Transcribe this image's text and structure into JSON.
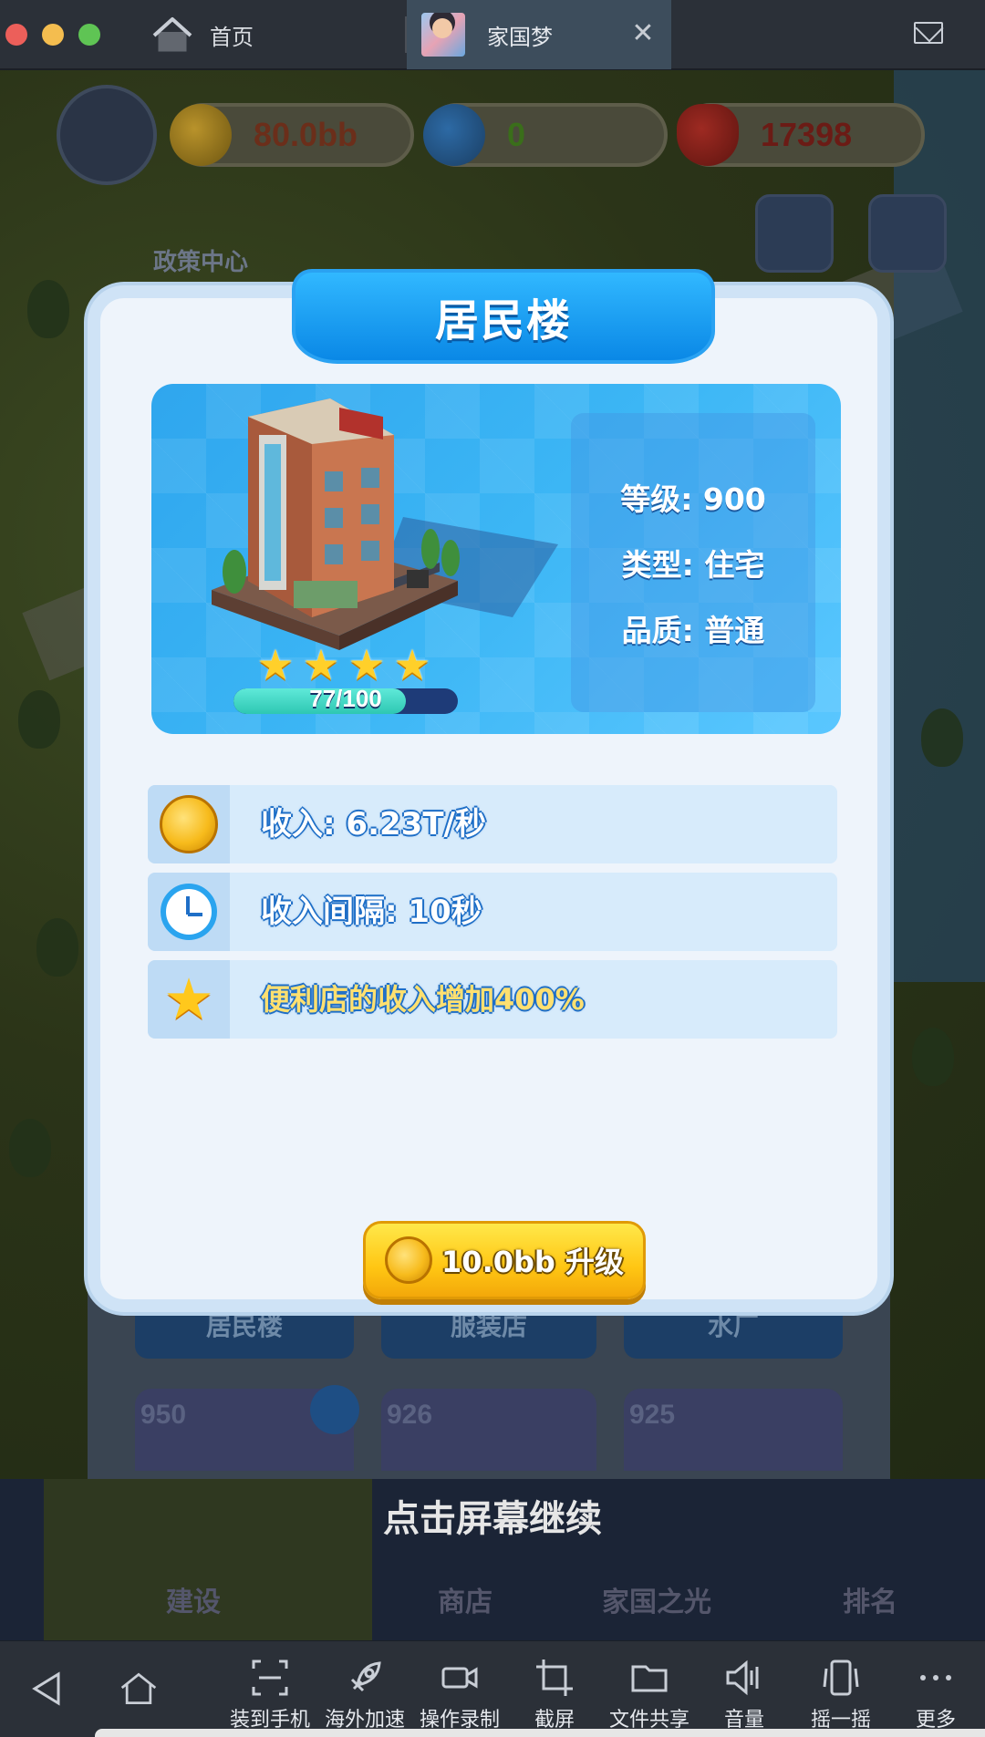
{
  "window": {
    "tabs": [
      {
        "label": "首页",
        "icon": "home-icon"
      },
      {
        "label": "家国梦",
        "icon": "game-thumbnail",
        "close": "✕"
      }
    ],
    "mail_icon": "mail-icon"
  },
  "hud": {
    "coins": "80.0bb",
    "stars": "0",
    "hearts": "17398",
    "policy_center": "政策中心"
  },
  "modal": {
    "title": "居民楼",
    "stats": {
      "level": "等级: 900",
      "type": "类型: 住宅",
      "quality": "品质: 普通"
    },
    "star_count": 4,
    "progress": {
      "current": 77,
      "max": 100,
      "label": "77/100"
    },
    "attributes": [
      {
        "icon": "coin-icon",
        "text": "收入: 6.23T/秒"
      },
      {
        "icon": "clock-icon",
        "text": "收入间隔: 10秒"
      },
      {
        "icon": "star-icon",
        "text": "便利店的收入增加400%"
      }
    ],
    "upgrade": {
      "cost": "10.0bb",
      "label": "升级",
      "text": "10.0bb 升级"
    }
  },
  "background": {
    "tabs": [
      "居民楼",
      "服装店",
      "水厂"
    ],
    "cards": [
      "950",
      "926",
      "925"
    ],
    "nav": [
      "建设",
      "商店",
      "家国之光",
      "排名"
    ],
    "continue": "点击屏幕继续"
  },
  "toolbar": [
    {
      "icon": "back-icon",
      "label": ""
    },
    {
      "icon": "home-icon",
      "label": ""
    },
    {
      "icon": "install-to-phone-icon",
      "label": "装到手机"
    },
    {
      "icon": "rocket-icon",
      "label": "海外加速"
    },
    {
      "icon": "record-icon",
      "label": "操作录制"
    },
    {
      "icon": "crop-icon",
      "label": "截屏"
    },
    {
      "icon": "folder-icon",
      "label": "文件共享"
    },
    {
      "icon": "volume-icon",
      "label": "音量"
    },
    {
      "icon": "shake-icon",
      "label": "摇一摇"
    },
    {
      "icon": "more-icon",
      "label": "更多"
    }
  ]
}
